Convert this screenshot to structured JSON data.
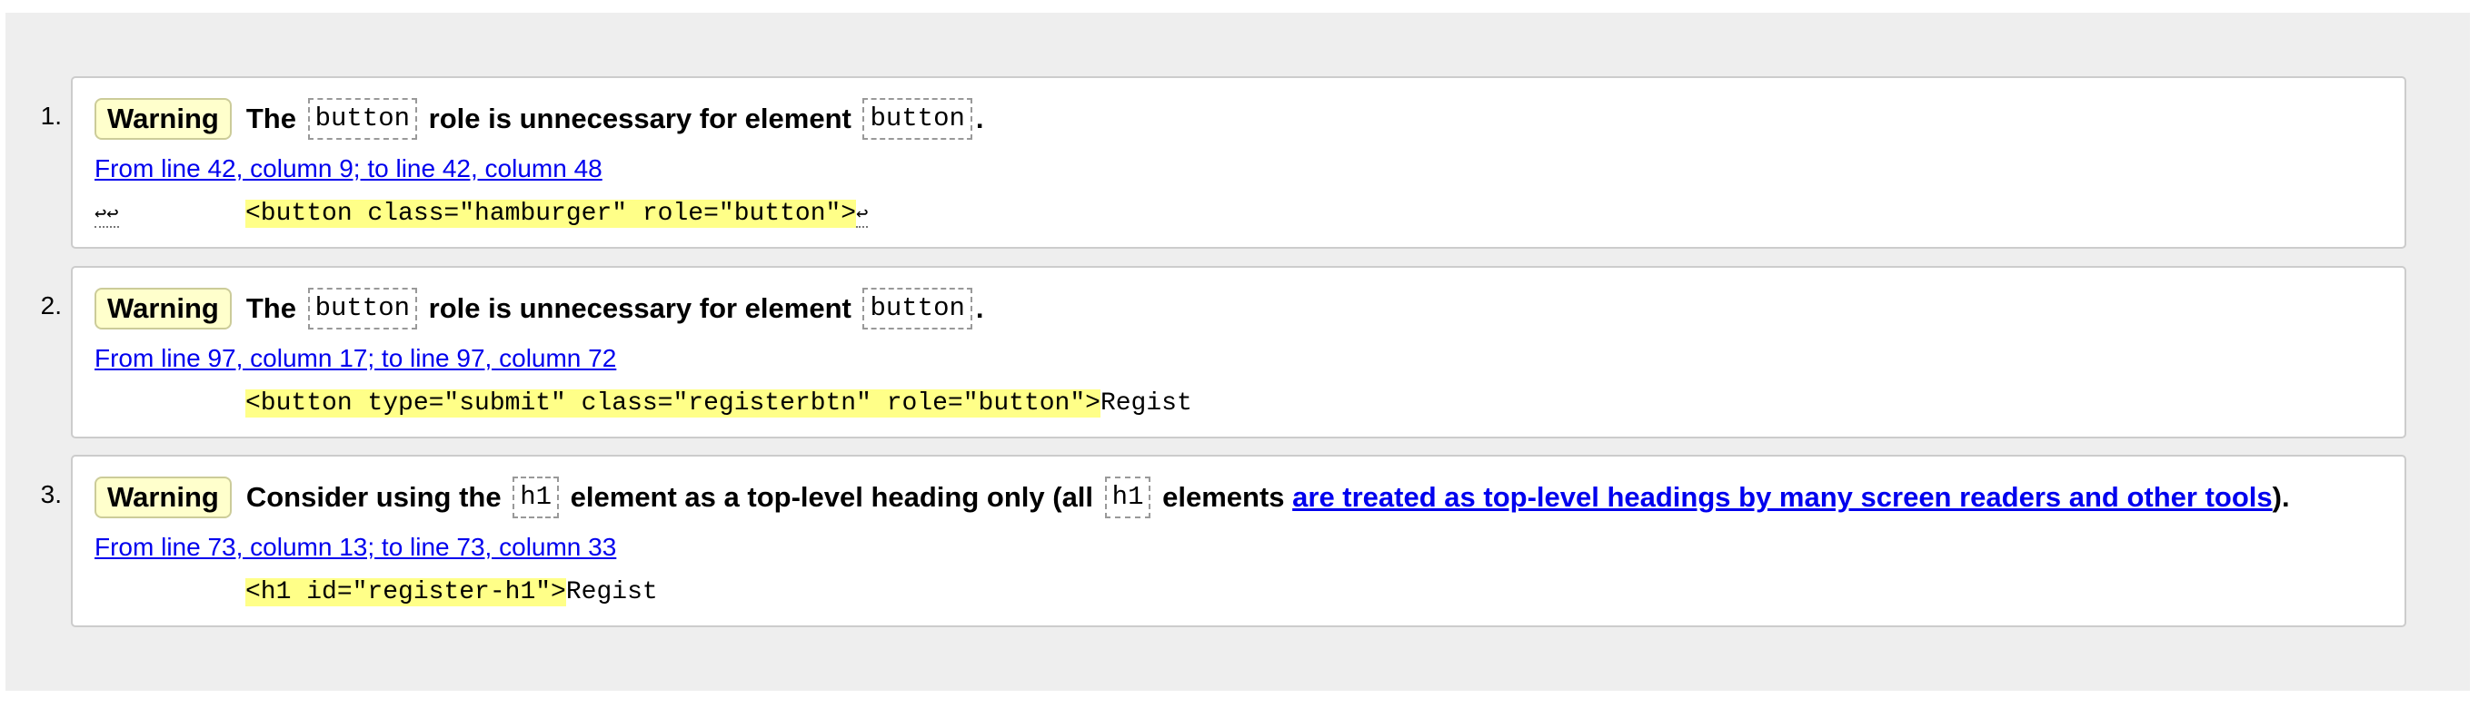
{
  "messages": [
    {
      "number": "1.",
      "type": "Warning",
      "headline": {
        "prefix": "The",
        "code1": "button",
        "middle": "role is unnecessary for element",
        "code2": "button",
        "suffix": "."
      },
      "location": "From line 42, column 9; to line 42, column 48",
      "extract": {
        "lead": "↩↩",
        "highlight": "<button class=\"hamburger\" role=\"button\">",
        "trail": "↩"
      }
    },
    {
      "number": "2.",
      "type": "Warning",
      "headline": {
        "prefix": "The",
        "code1": "button",
        "middle": "role is unnecessary for element",
        "code2": "button",
        "suffix": "."
      },
      "location": "From line 97, column 17; to line 97, column 72",
      "extract": {
        "highlight": "<button type=\"submit\" class=\"registerbtn\" role=\"button\">",
        "trail": "Regist"
      }
    },
    {
      "number": "3.",
      "type": "Warning",
      "headline": {
        "prefix": "Consider using the",
        "code1": "h1",
        "middle": "element as a top-level heading only (all",
        "code2": "h1",
        "middle2": "elements",
        "link": "are treated as top-level headings by many screen readers and other tools",
        "suffix": ")."
      },
      "location": "From line 73, column 13; to line 73, column 33",
      "extract": {
        "highlight": "<h1 id=\"register-h1\">",
        "trail": "Regist"
      }
    }
  ]
}
